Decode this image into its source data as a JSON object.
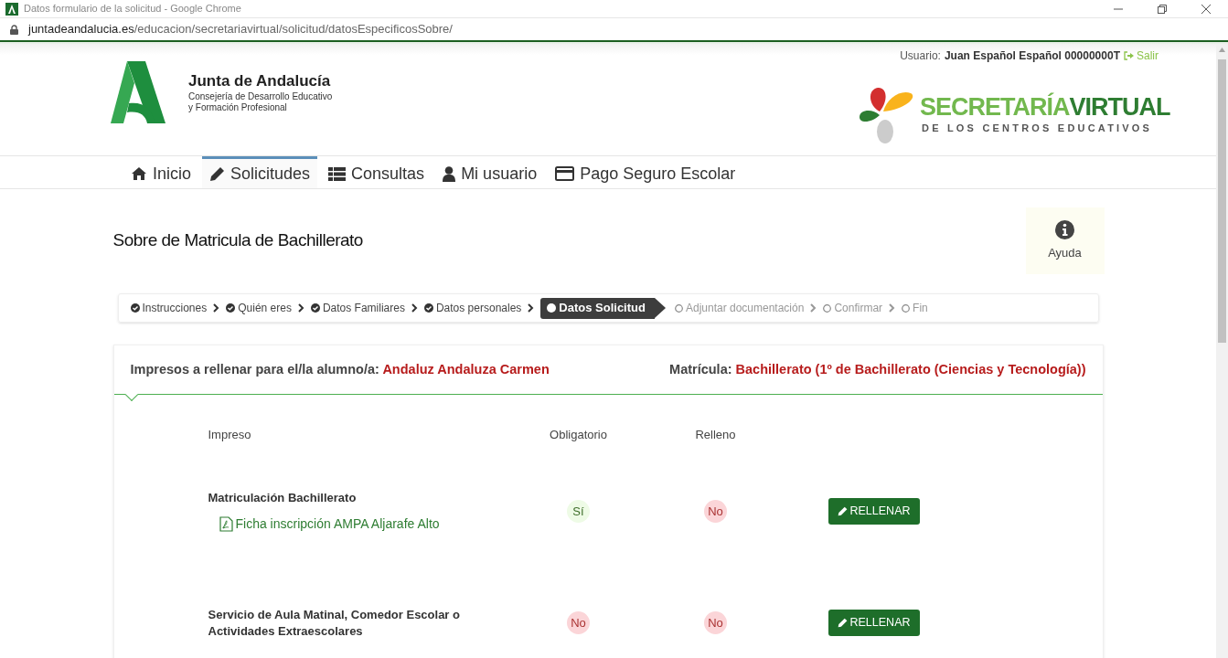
{
  "window": {
    "title": "Datos formulario de la solicitud - Google Chrome"
  },
  "address_bar": {
    "domain": "juntadeandalucia.es",
    "path": "/educacion/secretariavirtual/solicitud/datosEspecificosSobre/"
  },
  "header": {
    "user_label": "Usuario:",
    "user_name": "Juan Español Español 00000000T",
    "logout": "Salir",
    "org_name": "Junta de Andalucía",
    "org_line_1": "Consejería de Desarrollo Educativo",
    "org_line_2": "y Formación Profesional",
    "brand_1": "SECRETARÍA",
    "brand_2": "VIRTUAL",
    "brand_sub": "DE LOS CENTROS EDUCATIVOS"
  },
  "nav": [
    {
      "label": "Inicio",
      "kind": "home",
      "selected": false
    },
    {
      "label": "Solicitudes",
      "kind": "pencil",
      "selected": true
    },
    {
      "label": "Consultas",
      "kind": "list",
      "selected": false
    },
    {
      "label": "Mi usuario",
      "kind": "user",
      "selected": false
    },
    {
      "label": "Pago Seguro Escolar",
      "kind": "card",
      "selected": false
    }
  ],
  "page_title": "Sobre de Matricula de Bachillerato",
  "help": "Ayuda",
  "steps": [
    {
      "label": "Instrucciones",
      "kind": "done"
    },
    {
      "label": "Quién eres",
      "kind": "done"
    },
    {
      "label": "Datos Familiares",
      "kind": "done"
    },
    {
      "label": "Datos personales",
      "kind": "done"
    },
    {
      "label": "Datos Solicitud",
      "kind": "current"
    },
    {
      "label": "Adjuntar documentación",
      "kind": "pending"
    },
    {
      "label": "Confirmar",
      "kind": "pending"
    },
    {
      "label": "Fin",
      "kind": "pending"
    }
  ],
  "card": {
    "student_label": "Impresos a rellenar para el/la alumno/a:",
    "student_name": "Andaluz Andaluza Carmen",
    "enrol_label": "Matrícula:",
    "enrol_value": "Bachillerato (1º de Bachillerato (Ciencias y Tecnología))",
    "columns": [
      "Impreso",
      "Obligatorio",
      "Relleno"
    ],
    "rows": [
      {
        "title": "Matriculación Bachillerato",
        "attachment": "Ficha inscripción AMPA Aljarafe Alto",
        "mandatory": {
          "text": "Sí",
          "yes": true
        },
        "filled": {
          "text": "No",
          "yes": false
        },
        "button": "RELLENAR"
      },
      {
        "title": "Servicio de Aula Matinal, Comedor Escolar o Actividades Extraescolares",
        "mandatory": {
          "text": "No",
          "yes": false
        },
        "filled": {
          "text": "No",
          "yes": false
        },
        "button": "RELLENAR"
      }
    ]
  }
}
